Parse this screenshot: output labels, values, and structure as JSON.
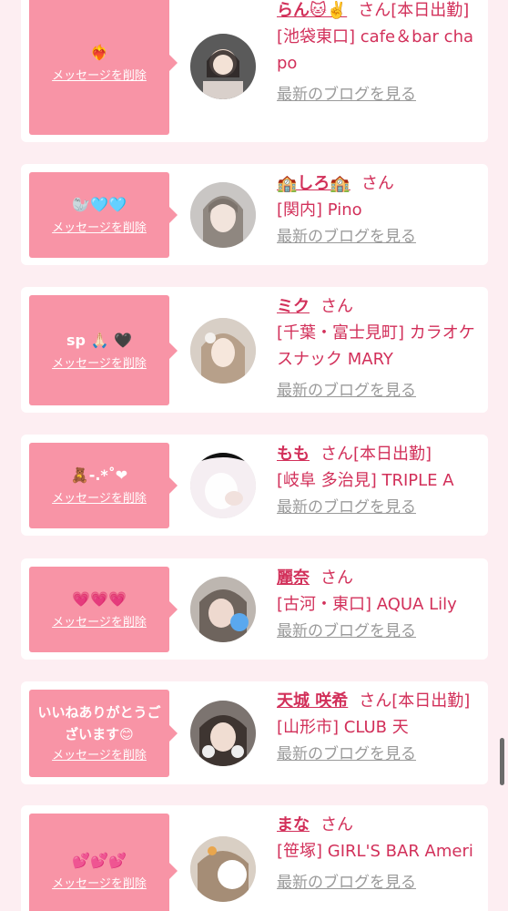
{
  "delete_label": "メッセージを削除",
  "blog_label": "最新のブログを見る",
  "san_suffix": "さん",
  "cards": [
    {
      "message": "❤️‍🔥",
      "name": "らん🐱✌️",
      "status": "[本日出勤]",
      "shop": "[池袋東口] cafe＆bar chapo"
    },
    {
      "message": "🦭🩵🩵",
      "name": "🏫しろ🏫",
      "status": "",
      "shop": "[関内] Pino"
    },
    {
      "message": "sp 🙏🏻 🖤",
      "name": "ミク",
      "status": "",
      "shop": "[千葉・富士見町] カラオケスナック MARY"
    },
    {
      "message": "🧸-.*˚❤",
      "name": "もも",
      "status": "[本日出勤]",
      "shop": "[岐阜 多治見] TRIPLE A"
    },
    {
      "message": "💗💗💗",
      "name": "麗奈",
      "status": "",
      "shop": "[古河・東口] AQUA Lily"
    },
    {
      "message": "いいねありがとうございます😊",
      "name": "天城 咲希",
      "status": "[本日出勤]",
      "shop": "[山形市] CLUB 天"
    },
    {
      "message": "💕💕💕",
      "name": "まな",
      "status": "",
      "shop": "[笹塚] GIRL'S BAR Ameri"
    }
  ],
  "colors": {
    "background": "#fdeef2",
    "bubble": "#f894a6",
    "name": "#d2305a",
    "link_gray": "#9a9a9a"
  }
}
